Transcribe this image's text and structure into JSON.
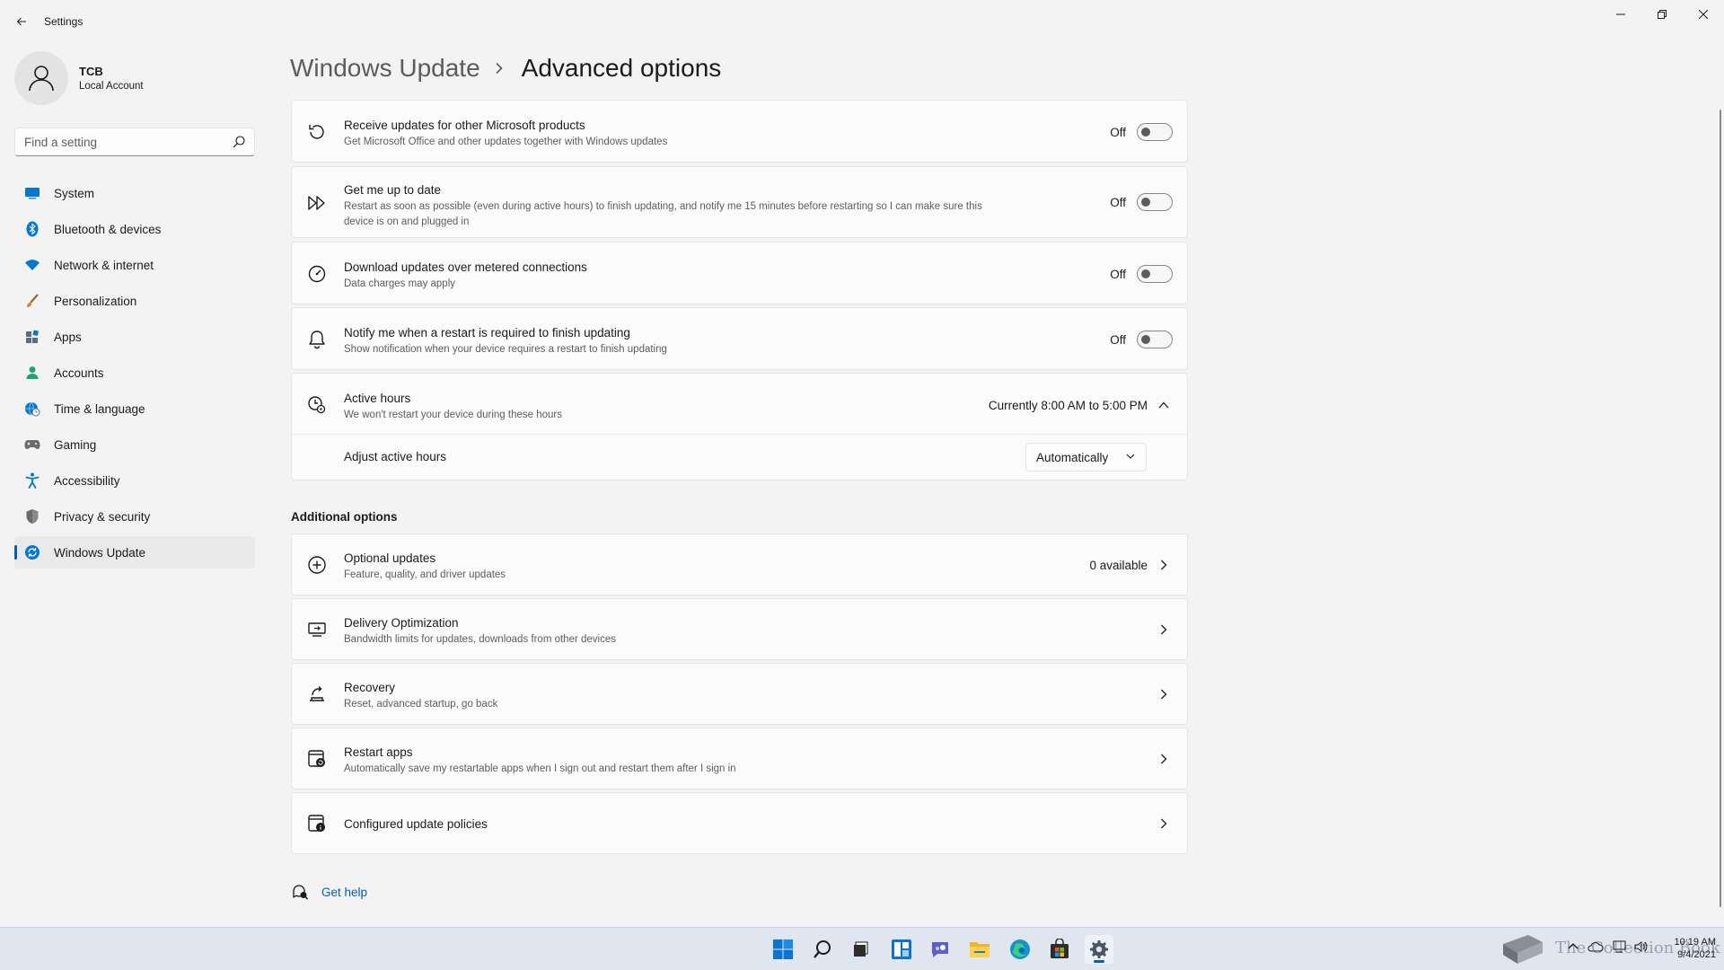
{
  "window": {
    "title": "Settings"
  },
  "user": {
    "name": "TCB",
    "account_type": "Local Account"
  },
  "search": {
    "placeholder": "Find a setting"
  },
  "sidebar": {
    "items": [
      {
        "label": "System",
        "icon": "system-icon",
        "color": "#0078d4"
      },
      {
        "label": "Bluetooth & devices",
        "icon": "bluetooth-icon",
        "color": "#0078d4"
      },
      {
        "label": "Network & internet",
        "icon": "wifi-icon",
        "color": "#0078d4"
      },
      {
        "label": "Personalization",
        "icon": "brush-icon",
        "color": "#e07a2e"
      },
      {
        "label": "Apps",
        "icon": "apps-icon",
        "color": "#5b6b80"
      },
      {
        "label": "Accounts",
        "icon": "accounts-icon",
        "color": "#1fa37a"
      },
      {
        "label": "Time & language",
        "icon": "globe-clock-icon",
        "color": "#0078d4"
      },
      {
        "label": "Gaming",
        "icon": "gamepad-icon",
        "color": "#6b6b6b"
      },
      {
        "label": "Accessibility",
        "icon": "accessibility-icon",
        "color": "#0078d4"
      },
      {
        "label": "Privacy & security",
        "icon": "shield-icon",
        "color": "#6b6b6b"
      },
      {
        "label": "Windows Update",
        "icon": "update-icon",
        "color": "#0078d4",
        "selected": true
      }
    ]
  },
  "header": {
    "parent": "Windows Update",
    "current": "Advanced options"
  },
  "settings": {
    "receive_updates": {
      "title": "Receive updates for other Microsoft products",
      "desc": "Get Microsoft Office and other updates together with Windows updates",
      "state": "Off"
    },
    "get_up_to_date": {
      "title": "Get me up to date",
      "desc": "Restart as soon as possible (even during active hours) to finish updating, and notify me 15 minutes before restarting so I can make sure this device is on and plugged in",
      "state": "Off"
    },
    "metered": {
      "title": "Download updates over metered connections",
      "desc": "Data charges may apply",
      "state": "Off"
    },
    "notify_restart": {
      "title": "Notify me when a restart is required to finish updating",
      "desc": "Show notification when your device requires a restart to finish updating",
      "state": "Off"
    },
    "active_hours": {
      "title": "Active hours",
      "desc": "We won't restart your device during these hours",
      "value": "Currently 8:00 AM to 5:00 PM",
      "adjust_label": "Adjust active hours",
      "adjust_value": "Automatically"
    }
  },
  "additional": {
    "section_title": "Additional options",
    "items": [
      {
        "title": "Optional updates",
        "desc": "Feature, quality, and driver updates",
        "value": "0 available",
        "icon": "plus-circle-icon"
      },
      {
        "title": "Delivery Optimization",
        "desc": "Bandwidth limits for updates, downloads from other devices",
        "value": "",
        "icon": "delivery-icon"
      },
      {
        "title": "Recovery",
        "desc": "Reset, advanced startup, go back",
        "value": "",
        "icon": "recovery-icon"
      },
      {
        "title": "Restart apps",
        "desc": "Automatically save my restartable apps when I sign out and restart them after I sign in",
        "value": "",
        "icon": "restart-apps-icon"
      },
      {
        "title": "Configured update policies",
        "desc": "",
        "value": "",
        "icon": "policy-icon"
      }
    ]
  },
  "help": {
    "label": "Get help"
  },
  "taskbar": {
    "apps": [
      "start-icon",
      "search-icon",
      "task-view-icon",
      "widgets-icon",
      "chat-icon",
      "file-explorer-icon",
      "edge-icon",
      "store-icon",
      "settings-icon"
    ],
    "watermark": "The Collection Book",
    "time": "10:19 AM",
    "date": "9/4/2021"
  },
  "colors": {
    "accent": "#005fb8",
    "background": "#f3f3f3",
    "card": "#fbfbfb"
  }
}
